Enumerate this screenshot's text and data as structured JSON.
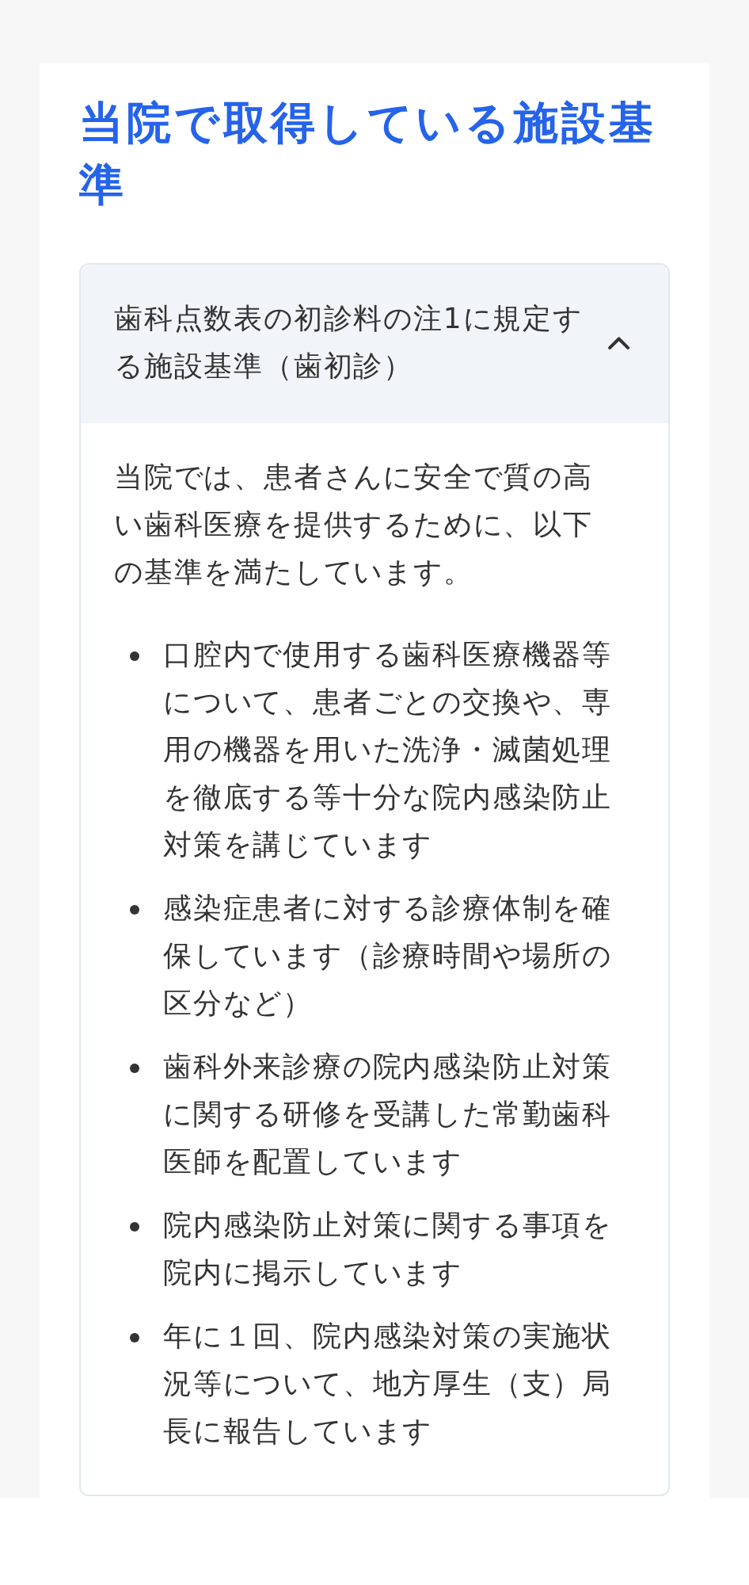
{
  "section": {
    "title": "当院で取得している施設基準"
  },
  "accordion": {
    "title": "歯科点数表の初診料の注1に規定する施設基準（歯初診）",
    "expanded": true,
    "intro": "当院では、患者さんに安全で質の高い歯科医療を提供するために、以下の基準を満たしています。",
    "items": [
      "口腔内で使用する歯科医療機器等について、患者ごとの交換や、専用の機器を用いた洗浄・滅菌処理を徹底する等十分な院内感染防止対策を講じています",
      "感染症患者に対する診療体制を確保しています（診療時間や場所の区分など）",
      "歯科外来診療の院内感染防止対策に関する研修を受講した常勤歯科医師を配置しています",
      "院内感染防止対策に関する事項を院内に掲示しています",
      "年に１回、院内感染対策の実施状況等について、地方厚生（支）局長に報告しています"
    ]
  }
}
